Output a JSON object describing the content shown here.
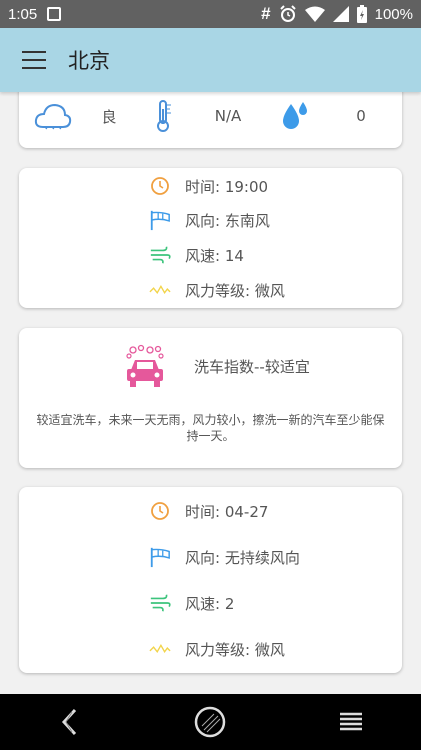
{
  "status_bar": {
    "time": "1:05",
    "hash": "#",
    "battery": "100%"
  },
  "app_bar": {
    "title": "北京"
  },
  "air_card": {
    "quality": "良",
    "temperature": "N/A",
    "humidity": "0"
  },
  "wind_card_1": {
    "time": "时间: 19:00",
    "direction": "风向: 东南风",
    "speed": "风速: 14",
    "level": "风力等级: 微风"
  },
  "wash_card": {
    "title": "洗车指数--较适宜",
    "text": "较适宜洗车，未来一天无雨，风力较小，擦洗一新的汽车至少能保持一天。"
  },
  "wind_card_2": {
    "time": "时间: 04-27",
    "direction": "风向: 无持续风向",
    "speed": "风速: 2",
    "level": "风力等级: 微风"
  },
  "icons": [
    "cloud-icon",
    "thermometer-icon",
    "water-drop-icon",
    "clock-icon",
    "wind-direction-icon",
    "wind-speed-icon",
    "wind-level-icon",
    "car-wash-icon"
  ]
}
